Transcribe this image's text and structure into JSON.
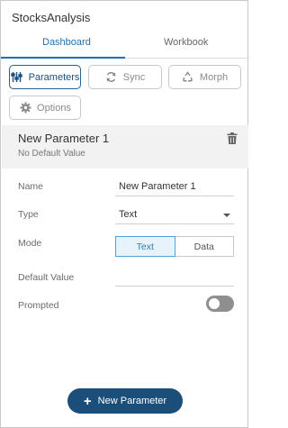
{
  "app": {
    "title": "StocksAnalysis"
  },
  "tabs": [
    {
      "label": "Dashboard",
      "active": true
    },
    {
      "label": "Workbook",
      "active": false
    }
  ],
  "toolbar": {
    "parameters": {
      "label": "Parameters",
      "icon": "sliders-icon"
    },
    "sync": {
      "label": "Sync",
      "icon": "sync-icon"
    },
    "morph": {
      "label": "Morph",
      "icon": "recycle-icon"
    },
    "options": {
      "label": "Options",
      "icon": "gear-icon"
    }
  },
  "parameter": {
    "name": "New Parameter 1",
    "default_text": "No Default Value"
  },
  "form": {
    "name_label": "Name",
    "name_value": "New Parameter 1",
    "type_label": "Type",
    "type_value": "Text",
    "mode_label": "Mode",
    "mode_options": [
      "Text",
      "Data"
    ],
    "mode_selected": "Text",
    "default_label": "Default Value",
    "default_value": "",
    "prompted_label": "Prompted",
    "prompted": false
  },
  "actions": {
    "new_parameter": "New Parameter"
  },
  "colors": {
    "accent": "#1f6fb2",
    "primary_button": "#1c4e7a",
    "mode_active": "#4aa3db"
  }
}
